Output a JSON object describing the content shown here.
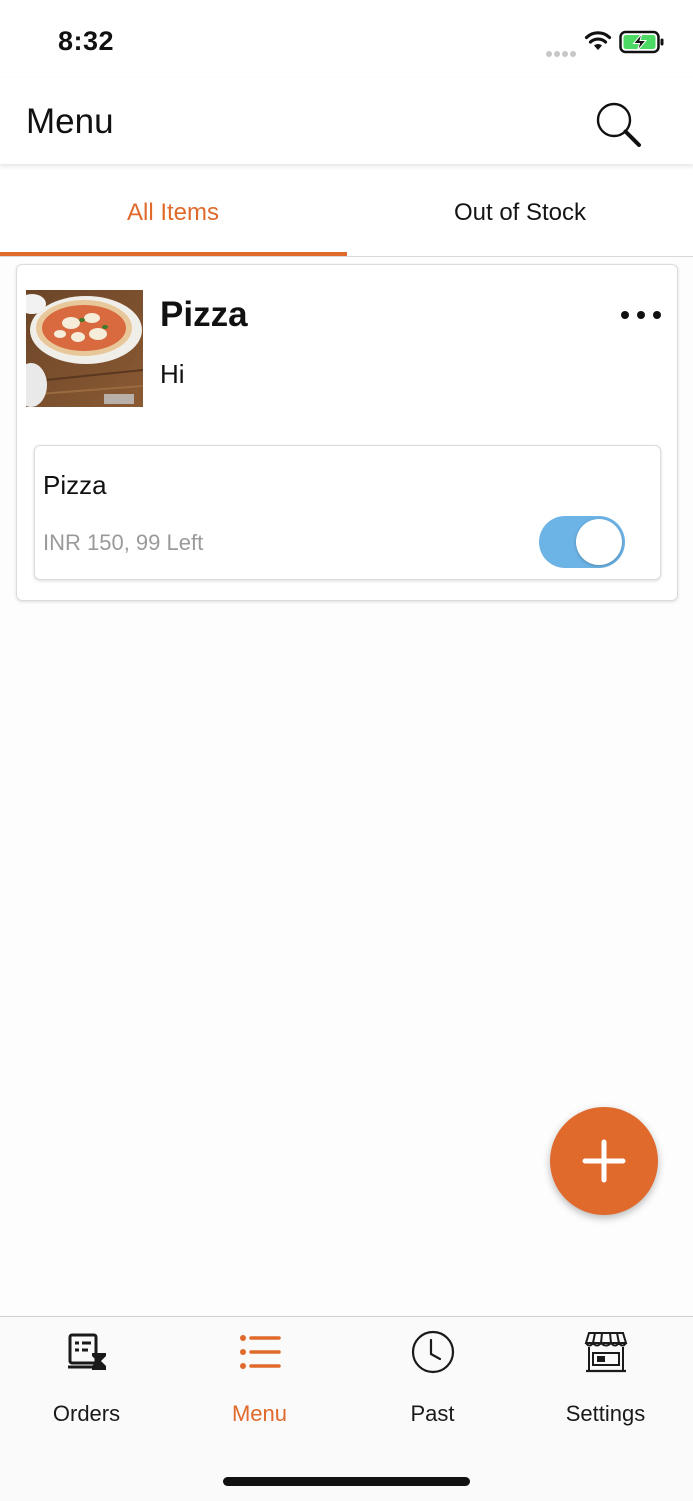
{
  "status_bar": {
    "time": "8:32"
  },
  "header": {
    "title": "Menu",
    "search_icon": "search-icon"
  },
  "tabs": [
    {
      "label": "All Items",
      "active": true
    },
    {
      "label": "Out of Stock",
      "active": false
    }
  ],
  "colors": {
    "accent": "#e06a2c",
    "toggle_on": "#6cb4e6"
  },
  "items": [
    {
      "name": "Pizza",
      "description": "Hi",
      "variants": [
        {
          "name": "Pizza",
          "meta": "INR 150, 99 Left",
          "in_stock": true
        }
      ]
    }
  ],
  "bottom_nav": [
    {
      "label": "Orders",
      "icon": "orders-icon",
      "active": false
    },
    {
      "label": "Menu",
      "icon": "menu-list-icon",
      "active": true
    },
    {
      "label": "Past",
      "icon": "clock-icon",
      "active": false
    },
    {
      "label": "Settings",
      "icon": "store-icon",
      "active": false
    }
  ]
}
